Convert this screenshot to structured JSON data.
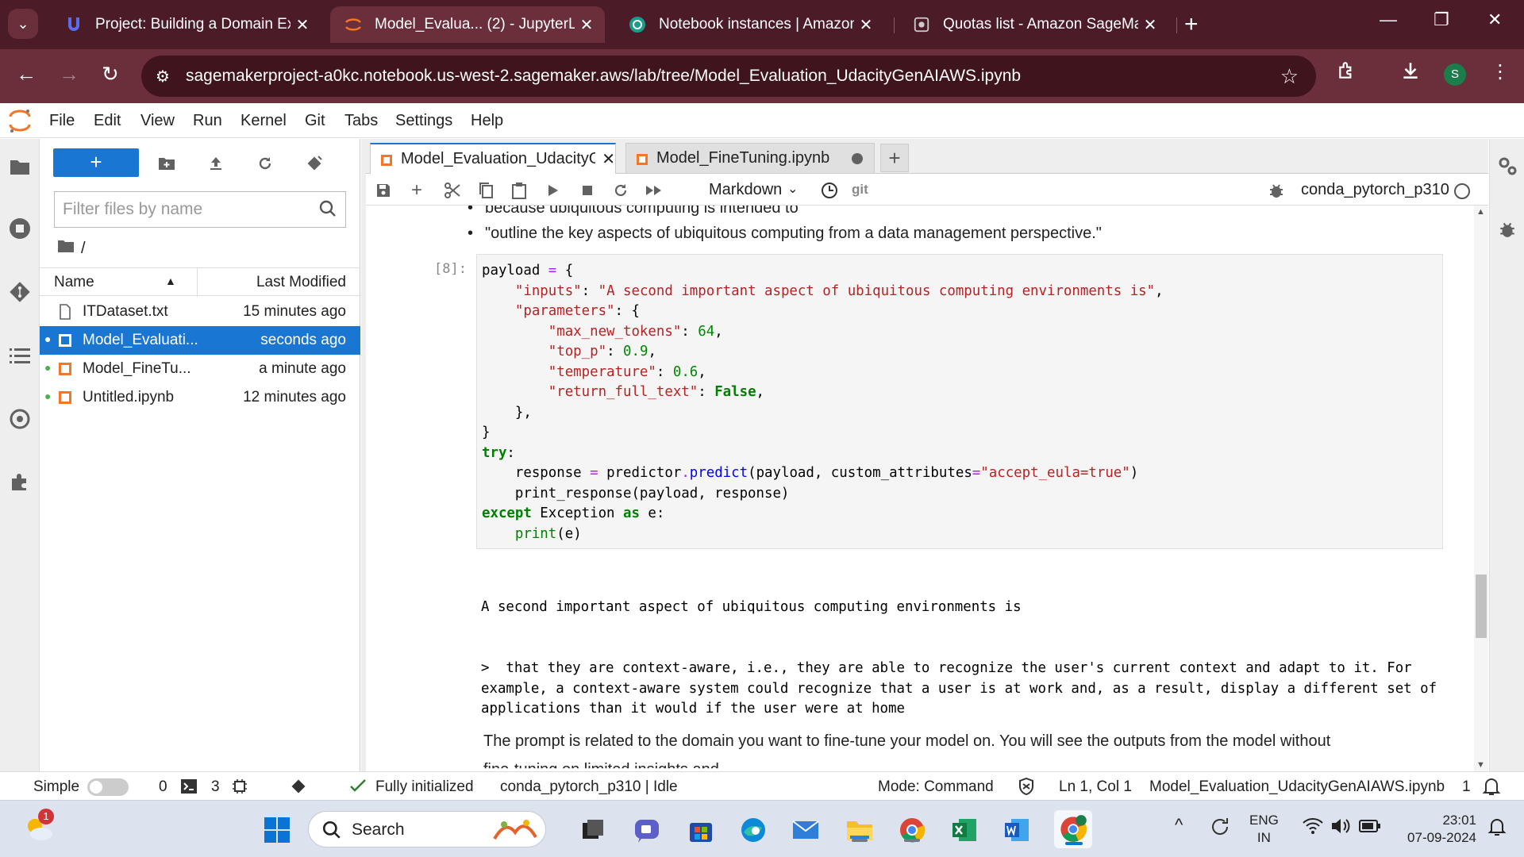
{
  "browser": {
    "tabs": [
      {
        "label": "Project: Building a Domain Expe",
        "icon": "udacity-icon"
      },
      {
        "label": "Model_Evalua... (2) - JupyterLab",
        "icon": "jupyter-icon"
      },
      {
        "label": "Notebook instances | Amazon S",
        "icon": "sagemaker-icon"
      },
      {
        "label": "Quotas list - Amazon SageMake",
        "icon": "quotas-icon"
      }
    ],
    "url": "sagemakerproject-a0kc.notebook.us-west-2.sagemaker.aws/lab/tree/Model_Evaluation_UdacityGenAIAWS.ipynb",
    "profile_initial": "S"
  },
  "jupyter": {
    "menu": [
      "File",
      "Edit",
      "View",
      "Run",
      "Kernel",
      "Git",
      "Tabs",
      "Settings",
      "Help"
    ],
    "filebrowser": {
      "new_label": "+",
      "search_placeholder": "Filter files by name",
      "breadcrumb": "/",
      "col_name": "Name",
      "col_modified": "Last Modified",
      "files": [
        {
          "name": "ITDataset.txt",
          "modified": "15 minutes ago",
          "running": false,
          "selected": false
        },
        {
          "name": "Model_Evaluati...",
          "modified": "seconds ago",
          "running": true,
          "selected": true
        },
        {
          "name": "Model_FineTu...",
          "modified": "a minute ago",
          "running": true,
          "selected": false
        },
        {
          "name": "Untitled.ipynb",
          "modified": "12 minutes ago",
          "running": true,
          "selected": false
        }
      ]
    },
    "doc_tabs": [
      {
        "label": "Model_Evaluation_UdacityGe",
        "active": true
      },
      {
        "label": "Model_FineTuning.ipynb",
        "active": false
      }
    ],
    "toolbar": {
      "cell_type": "Markdown",
      "git_label": "git",
      "kernel": "conda_pytorch_p310"
    },
    "notebook": {
      "bullets": [
        "because ubiquitous computing is intended to",
        "\"outline the key aspects of ubiquitous computing from a data management perspective.\""
      ],
      "cell_prompt": "[8]:",
      "output_lines": [
        "A second important aspect of ubiquitous computing environments is",
        ">  that they are context-aware, i.e., they are able to recognize the user's current context and adapt to it. For example, a context-aware system could recognize that a user is at work and, as a result, display a different set of applications than it would if the user were at home",
        "",
        "=================================="
      ],
      "markdown_text": "The prompt is related to the domain you want to fine-tune your model on. You will see the outputs from the model without",
      "markdown_text_cut": "fine-tuning on limited insights and ..."
    },
    "statusbar": {
      "mode_simple": "Simple",
      "terminals": "0",
      "kernels": "3",
      "init_status": "Fully initialized",
      "kernel_status": "conda_pytorch_p310 | Idle",
      "mode": "Mode: Command",
      "cursor": "Ln 1, Col 1",
      "filename": "Model_Evaluation_UdacityGenAIAWS.ipynb",
      "notifications": "1"
    }
  },
  "taskbar": {
    "search_label": "Search",
    "weather_badge": "1",
    "language": "ENG",
    "region": "IN",
    "time": "23:01",
    "date": "07-09-2024"
  }
}
